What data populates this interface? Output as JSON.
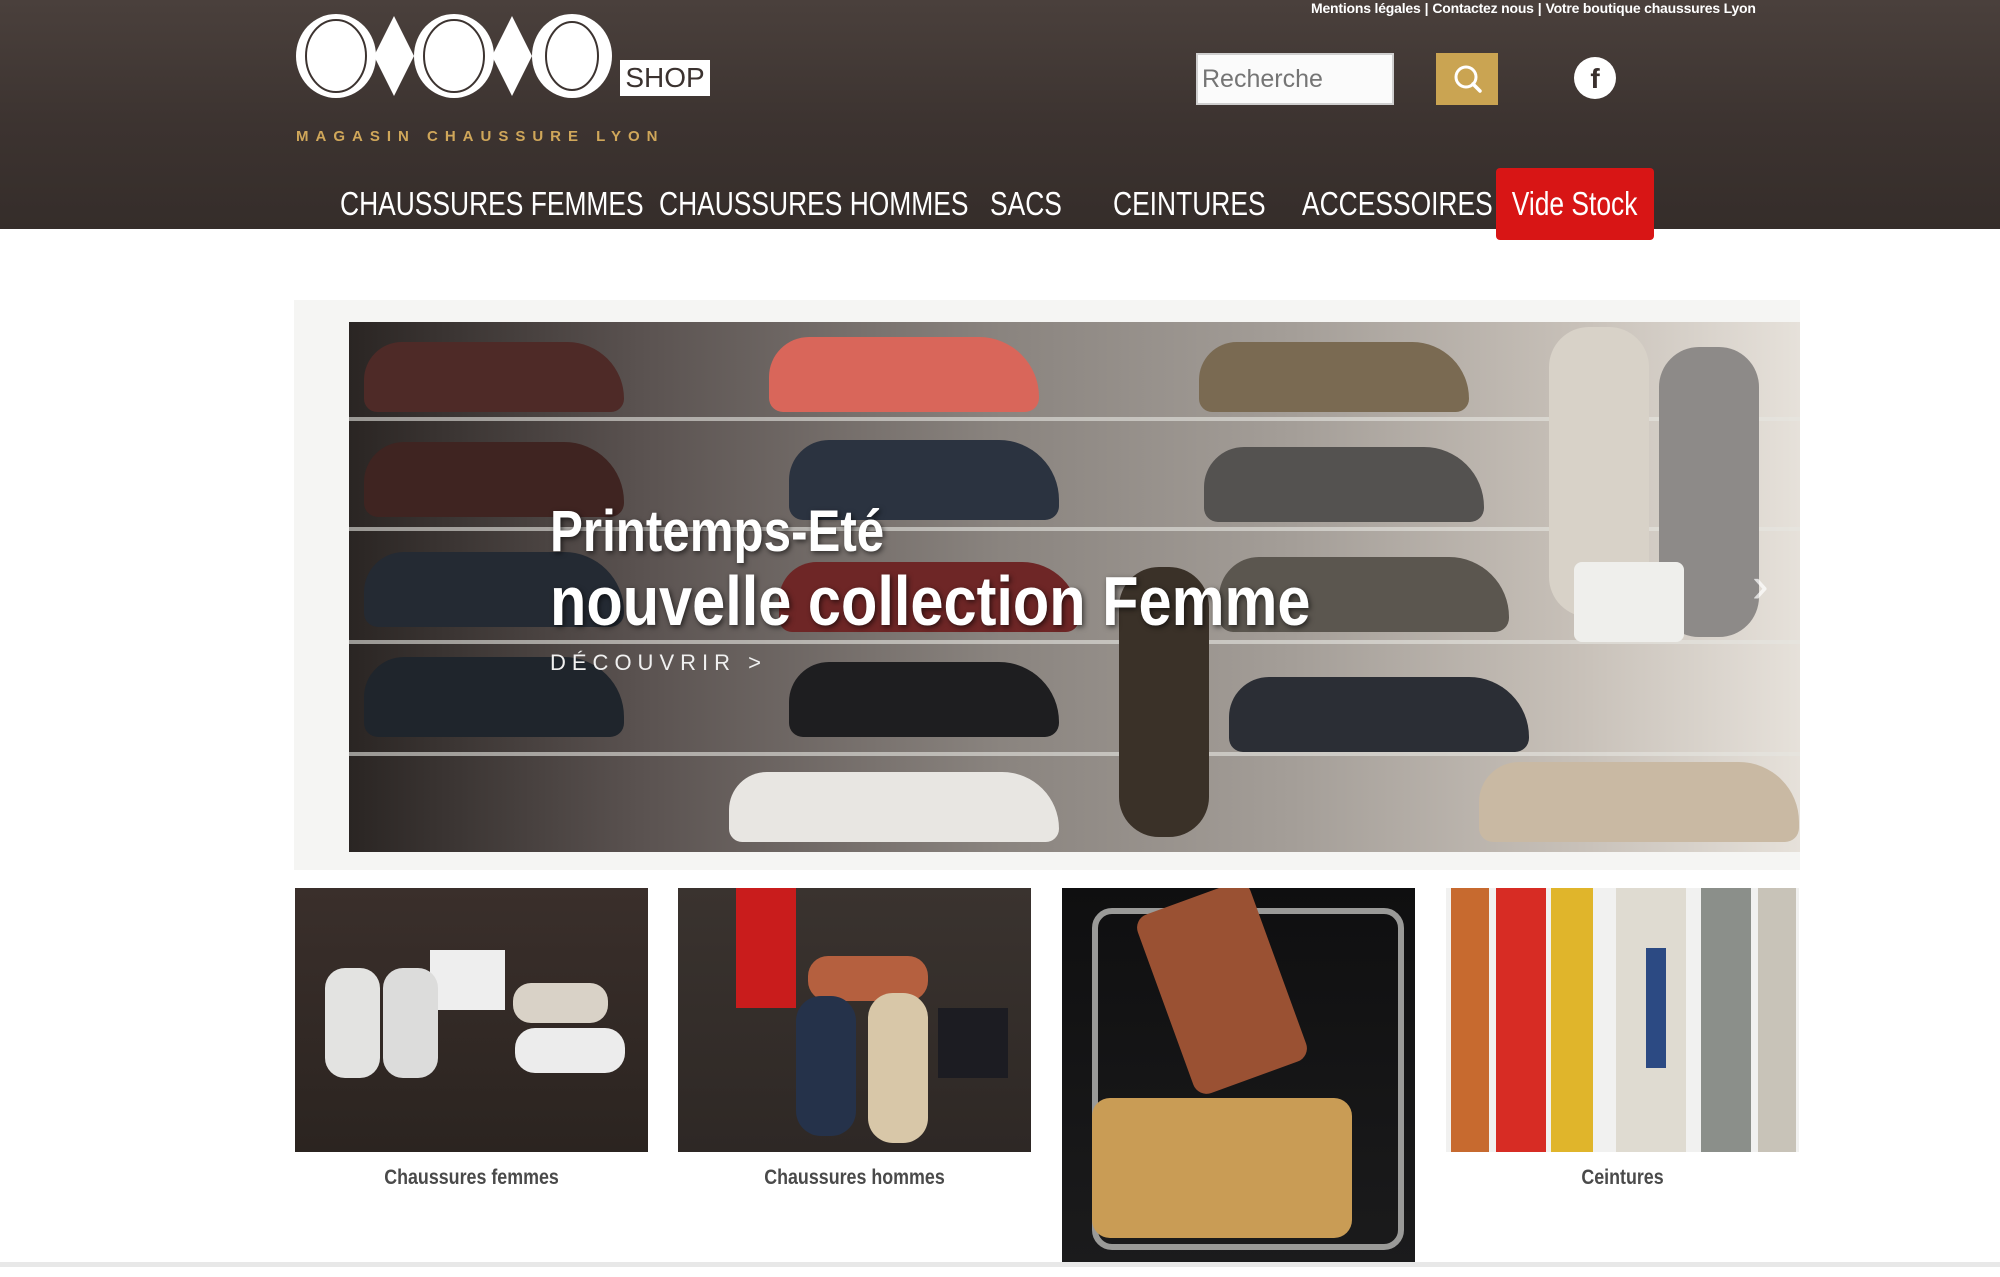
{
  "top_links": [
    "Mentions légales",
    "Contactez nous",
    "Votre boutique chaussures Lyon"
  ],
  "top_links_separator": "|",
  "logo": {
    "shop_label": "SHOP",
    "tagline": "MAGASIN CHAUSSURE LYON"
  },
  "search": {
    "placeholder": "Recherche",
    "icon": "search-icon"
  },
  "social": {
    "facebook_glyph": "f",
    "icon": "facebook-icon"
  },
  "nav": {
    "items": [
      "CHAUSSURES FEMMES",
      "CHAUSSURES HOMMES",
      "SACS",
      "CEINTURES",
      "ACCESSOIRES"
    ],
    "highlight": "Vide Stock"
  },
  "hero": {
    "title_line1": "Printemps-Eté",
    "title_line2": "nouvelle collection Femme",
    "cta": "DÉCOUVRIR  >",
    "next_arrow": "›"
  },
  "categories": [
    "Chaussures femmes",
    "Chaussures hommes",
    "",
    "Ceintures"
  ],
  "colors": {
    "header_bg": "#3c3330",
    "accent_gold": "#caa452",
    "vide_stock_red": "#d81515"
  }
}
